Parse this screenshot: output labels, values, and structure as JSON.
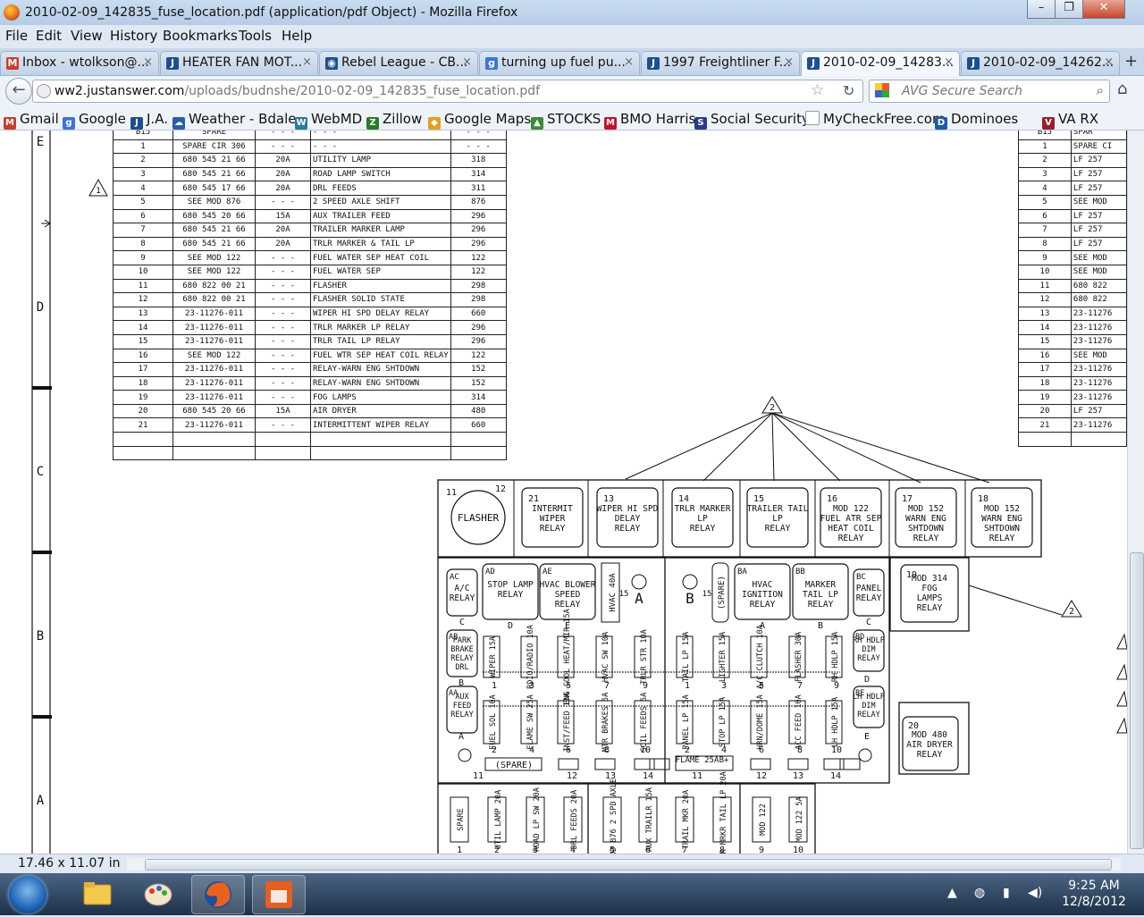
{
  "window": {
    "title": "2010-02-09_142835_fuse_location.pdf (application/pdf Object) - Mozilla Firefox",
    "controls": [
      "–",
      "❐",
      "✕"
    ]
  },
  "menu": [
    "File",
    "Edit",
    "View",
    "History",
    "Bookmarks",
    "Tools",
    "Help"
  ],
  "tabs": [
    {
      "label": "Inbox - wtolkson@...",
      "icon": "gmail-icon",
      "color": "#cc3b2b",
      "glyph": "M",
      "active": false
    },
    {
      "label": "HEATER FAN MOT...",
      "icon": "justanswer-icon",
      "color": "#1b4f8f",
      "glyph": "J",
      "active": false
    },
    {
      "label": "Rebel League - CB...",
      "icon": "cbs-eye-icon",
      "color": "#1b4f8f",
      "glyph": "◉",
      "active": false
    },
    {
      "label": "turning up fuel pu...",
      "icon": "google-icon",
      "color": "#3b73d8",
      "glyph": "g",
      "active": false
    },
    {
      "label": "1997 Freightliner F...",
      "icon": "justanswer-icon",
      "color": "#1b4f8f",
      "glyph": "J",
      "active": false
    },
    {
      "label": "2010-02-09_14283...",
      "icon": "justanswer-icon",
      "color": "#1b4f8f",
      "glyph": "J",
      "active": true
    },
    {
      "label": "2010-02-09_14262...",
      "icon": "justanswer-icon",
      "color": "#1b4f8f",
      "glyph": "J",
      "active": false
    }
  ],
  "tab_close": "×",
  "new_tab": "+",
  "url": {
    "domain": "ww2.justanswer.com",
    "path": "/uploads/budnshe/2010-02-09_142835_fuse_location.pdf"
  },
  "search": {
    "placeholder": "AVG Secure Search"
  },
  "bookmarks": [
    {
      "label": "Gmail",
      "color": "#cc3b2b",
      "glyph": "M"
    },
    {
      "label": "Google",
      "color": "#3b73d8",
      "glyph": "g"
    },
    {
      "label": "J.A.",
      "color": "#1b4f8f",
      "glyph": "J"
    },
    {
      "label": "Weather - Bdale",
      "color": "#2a5ea8",
      "glyph": "☁"
    },
    {
      "label": "WebMD",
      "color": "#2a7a9a",
      "glyph": "W"
    },
    {
      "label": "Zillow",
      "color": "#2a7a2a",
      "glyph": "Z"
    },
    {
      "label": "Google Maps",
      "color": "#e0a020",
      "glyph": "◆"
    },
    {
      "label": "STOCKS",
      "color": "#3a8a3a",
      "glyph": "▲"
    },
    {
      "label": "BMO Harris",
      "color": "#c8102e",
      "glyph": "M"
    },
    {
      "label": "Social Security",
      "color": "#2a3a8a",
      "glyph": "S"
    },
    {
      "label": "MyCheckFree.com",
      "color": "#888888",
      "glyph": ""
    },
    {
      "label": "Dominoes",
      "color": "#1f5aa8",
      "glyph": "D"
    },
    {
      "label": "VA RX",
      "color": "#9a1f2e",
      "glyph": "V"
    }
  ],
  "status": {
    "page_size": "17.46 x 11.07 in"
  },
  "clock": {
    "time": "9:25 AM",
    "date": "12/8/2012"
  },
  "pdf": {
    "border_letters": [
      "E",
      "D",
      "C",
      "B",
      "A"
    ],
    "left_table": {
      "header": [
        "B15",
        "SPARE",
        "- - -",
        "- - -",
        "- - -"
      ],
      "rows": [
        [
          "1",
          "SPARE CIR 306",
          "- - -",
          "- - -",
          "- - -"
        ],
        [
          "2",
          "680 545 21 66",
          "20A",
          "UTILITY LAMP",
          "318"
        ],
        [
          "3",
          "680 545 21 66",
          "20A",
          "ROAD LAMP SWITCH",
          "314"
        ],
        [
          "4",
          "680 545 17 66",
          "20A",
          "DRL FEEDS",
          "311"
        ],
        [
          "5",
          "SEE MOD 876",
          "- - -",
          "2 SPEED AXLE SHIFT",
          "876"
        ],
        [
          "6",
          "680 545 20 66",
          "15A",
          "AUX TRAILER FEED",
          "296"
        ],
        [
          "7",
          "680 545 21 66",
          "20A",
          "TRAILER MARKER LAMP",
          "296"
        ],
        [
          "8",
          "680 545 21 66",
          "20A",
          "TRLR MARKER & TAIL LP",
          "296"
        ],
        [
          "9",
          "SEE MOD 122",
          "- - -",
          "FUEL WATER SEP HEAT COIL",
          "122"
        ],
        [
          "10",
          "SEE MOD 122",
          "- - -",
          "FUEL WATER SEP",
          "122"
        ],
        [
          "11",
          "680 822 00 21",
          "- - -",
          "FLASHER",
          "298"
        ],
        [
          "12",
          "680 822 00 21",
          "- - -",
          "FLASHER SOLID STATE",
          "298"
        ],
        [
          "13",
          "23-11276-011",
          "- - -",
          "WIPER HI SPD DELAY RELAY",
          "660"
        ],
        [
          "14",
          "23-11276-011",
          "- - -",
          "TRLR MARKER LP RELAY",
          "296"
        ],
        [
          "15",
          "23-11276-011",
          "- - -",
          "TRLR TAIL LP RELAY",
          "296"
        ],
        [
          "16",
          "SEE MOD 122",
          "- - -",
          "FUEL WTR SEP HEAT COIL RELAY",
          "122"
        ],
        [
          "17",
          "23-11276-011",
          "- - -",
          "RELAY-WARN ENG SHTDOWN",
          "152"
        ],
        [
          "18",
          "23-11276-011",
          "- - -",
          "RELAY-WARN ENG SHTDOWN",
          "152"
        ],
        [
          "19",
          "23-11276-011",
          "- - -",
          "FOG LAMPS",
          "314"
        ],
        [
          "20",
          "680 545 20 66",
          "15A",
          "AIR DRYER",
          "480"
        ],
        [
          "21",
          "23-11276-011",
          "- - -",
          "INTERMITTENT WIPER RELAY",
          "660"
        ],
        [
          "",
          "",
          "",
          "",
          ""
        ],
        [
          "",
          "",
          "",
          "",
          ""
        ]
      ]
    },
    "right_table": {
      "header": [
        "B15",
        "SPAR"
      ],
      "rows": [
        [
          "1",
          "SPARE CI"
        ],
        [
          "2",
          "LF 257"
        ],
        [
          "3",
          "LF 257"
        ],
        [
          "4",
          "LF 257"
        ],
        [
          "5",
          "SEE MOD"
        ],
        [
          "6",
          "LF 257"
        ],
        [
          "7",
          "LF 257"
        ],
        [
          "8",
          "LF 257"
        ],
        [
          "9",
          "SEE MOD"
        ],
        [
          "10",
          "SEE MOD"
        ],
        [
          "11",
          "680 822"
        ],
        [
          "12",
          "680 822"
        ],
        [
          "13",
          "23-11276"
        ],
        [
          "14",
          "23-11276"
        ],
        [
          "15",
          "23-11276"
        ],
        [
          "16",
          "SEE MOD"
        ],
        [
          "17",
          "23-11276"
        ],
        [
          "18",
          "23-11276"
        ],
        [
          "19",
          "23-11276"
        ],
        [
          "20",
          "LF 257"
        ],
        [
          "21",
          "23-11276"
        ],
        [
          "",
          ""
        ]
      ]
    },
    "callout": "2",
    "top_relays": [
      {
        "num": "21",
        "text": "INTERMIT\nWIPER\nRELAY"
      },
      {
        "num": "13",
        "text": "WIPER HI SPD\nDELAY\nRELAY"
      },
      {
        "num": "14",
        "text": "TRLR MARKER\nLP\nRELAY"
      },
      {
        "num": "15",
        "text": "TRAILER TAIL\nLP\nRELAY"
      },
      {
        "num": "16",
        "text": "MOD 122\nFUEL ATR SEP\nHEAT COIL\nRELAY"
      },
      {
        "num": "17",
        "text": "MOD 152\nWARN ENG\nSHTDOWN\nRELAY"
      },
      {
        "num": "18",
        "text": "MOD 152\nWARN ENG\nSHTDOWN\nRELAY"
      }
    ],
    "flasher": {
      "num_left": "11",
      "num_right": "12",
      "label": "FLASHER"
    },
    "mid_relays": [
      {
        "id": "AC",
        "text": "A/C\nRELAY",
        "letter": "C"
      },
      {
        "id": "AD",
        "text": "STOP LAMP\nRELAY",
        "letter": "D"
      },
      {
        "id": "AE",
        "text": "HVAC BLOWER\nSPEED\nRELAY",
        "letter": "E"
      },
      {
        "id": "BA",
        "text": "HVAC\nIGNITION\nRELAY",
        "letter": "A"
      },
      {
        "id": "BB",
        "text": "MARKER\nTAIL LP\nRELAY",
        "letter": "B"
      },
      {
        "id": "BC",
        "text": "PANEL\nRELAY",
        "letter": "C"
      }
    ],
    "hvac_fuse": "HVAC 40A",
    "spare_vertical": "(SPARE)",
    "fog_relay": {
      "num": "19",
      "text": "MOD 314\nFOG\nLAMPS\nRELAY"
    },
    "side_relays": [
      {
        "id": "AB",
        "text": "PARK\nBRAKE\nRELAY\nDRL",
        "letter": "B"
      },
      {
        "id": "AA",
        "text": "AUX\nFEED\nRELAY",
        "letter": "A"
      },
      {
        "id": "BD",
        "text": "RH HDLP\nDIM\nRELAY",
        "letter": "D"
      },
      {
        "id": "BE",
        "text": "LH HDLP\nDIM\nRELAY",
        "letter": "E"
      }
    ],
    "air_dryer_relay": {
      "num": "20",
      "text": "MOD 480\nAIR DRYER\nRELAY"
    },
    "fuse_row_a": [
      {
        "n": "1",
        "t": "WIPER 15A"
      },
      {
        "n": "3",
        "t": "RDIO/RADIO 10A"
      },
      {
        "n": "5",
        "t": "ENG COOL HEAT/MIR 15A"
      },
      {
        "n": "7",
        "t": "HVAC SW 10A"
      },
      {
        "n": "9",
        "t": "TRLR STR 10A"
      },
      {
        "n": "1",
        "t": "TAIL LP 15A"
      },
      {
        "n": "3",
        "t": "LIGHTER 15A"
      },
      {
        "n": "5",
        "t": "A/C CLUTCH 10A"
      },
      {
        "n": "7",
        "t": "FLASHER 30A"
      },
      {
        "n": "9",
        "t": "RH HDLP 15A"
      }
    ],
    "fuse_row_b": [
      {
        "n": "2",
        "t": "FUEL SOL 10A"
      },
      {
        "n": "4",
        "t": "FLAME SW 25A"
      },
      {
        "n": "6",
        "t": "INST/FEED 10A"
      },
      {
        "n": "8",
        "t": "MTR BRAKES 5A"
      },
      {
        "n": "10",
        "t": "SOIL FEEDS 5A"
      },
      {
        "n": "2",
        "t": "PANEL LP 15A"
      },
      {
        "n": "4",
        "t": "STOP LP 15A"
      },
      {
        "n": "6",
        "t": "HRN/DOME 15A"
      },
      {
        "n": "8",
        "t": "ACC FEED 10A"
      },
      {
        "n": "10",
        "t": "LH HDLP 15A"
      }
    ],
    "small_nums_a": [
      "11",
      "12",
      "13",
      "14"
    ],
    "small_nums_b": [
      "11",
      "12",
      "13",
      "14"
    ],
    "spare_label": "(SPARE)",
    "flame_label": "FLAME 25A",
    "flame_bplus": "B+",
    "fuse_row_c": [
      {
        "n": "1",
        "t": "SPARE"
      },
      {
        "n": "2",
        "t": "UTIL LAMP 20A"
      },
      {
        "n": "3",
        "t": "ROAD LP SW 20A"
      },
      {
        "n": "4",
        "t": "DRL FEEDS 20A"
      },
      {
        "n": "5",
        "t": "MOD 876 2 SPD AXLE"
      },
      {
        "n": "6",
        "t": "AUX TRAILR 15A"
      },
      {
        "n": "7",
        "t": "TRAIL MKR 20A"
      },
      {
        "n": "8",
        "t": "TRLR MRKR TAIL LP 20A"
      },
      {
        "n": "9",
        "t": "MOD 122"
      },
      {
        "n": "10",
        "t": "MOD 122 5A"
      }
    ],
    "side_letters": {
      "c": "C",
      "b": "B",
      "a": "A",
      "e": "E",
      "d": "D"
    },
    "circle_letter_a": "A",
    "circle_letter_b": "B",
    "num_15": "15"
  }
}
